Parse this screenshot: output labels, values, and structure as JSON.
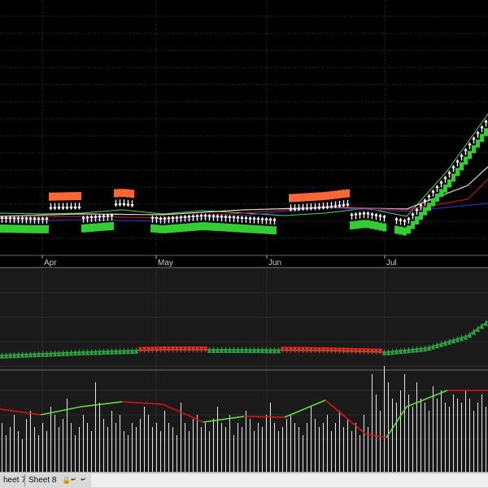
{
  "chart_data": [
    {
      "type": "line",
      "title": "",
      "x_tick_labels": [
        "Apr",
        "May",
        "Jun",
        "Jul"
      ],
      "series": [
        {
          "role": "price",
          "x": [
            0,
            10,
            20,
            30,
            40,
            50,
            60,
            70,
            80,
            90,
            100,
            110,
            120
          ],
          "values": [
            262,
            263,
            262,
            258,
            263,
            259,
            262,
            265,
            262,
            256,
            266,
            210,
            140
          ]
        },
        {
          "role": "sma-short",
          "x": [
            0,
            20,
            40,
            60,
            80,
            100,
            115,
            120
          ],
          "values": [
            266,
            263,
            264,
            258,
            255,
            257,
            228,
            205
          ]
        },
        {
          "role": "sma-mid",
          "x": [
            0,
            20,
            40,
            60,
            80,
            100,
            115,
            120
          ],
          "values": [
            268,
            266,
            268,
            262,
            254,
            258,
            245,
            220
          ]
        },
        {
          "role": "sma-long",
          "x": [
            0,
            20,
            40,
            60,
            80,
            100,
            120
          ],
          "values": [
            272,
            270,
            272,
            265,
            255,
            260,
            250
          ]
        }
      ],
      "signal_up_ranges": [
        [
          0,
          12
        ],
        [
          20,
          28
        ],
        [
          37,
          68
        ],
        [
          86,
          95
        ],
        [
          97,
          120
        ]
      ],
      "signal_down_ranges": [
        [
          12,
          20
        ],
        [
          28,
          33
        ],
        [
          71,
          86
        ],
        [
          88,
          93
        ]
      ],
      "colors": {
        "up": "#33cc33",
        "down": "#ff6633",
        "price": "#ffffff",
        "sma_long": "#3333cc",
        "background": "#000000"
      },
      "grid": true
    },
    {
      "type": "line",
      "title": "",
      "series": [
        {
          "role": "indicator",
          "x": [
            0,
            20,
            40,
            60,
            80,
            95,
            105,
            115,
            120
          ],
          "values": [
            437,
            433,
            430,
            430,
            431,
            433,
            428,
            413,
            395
          ]
        }
      ],
      "up_marker_ranges": [
        [
          0,
          34
        ],
        [
          51,
          69
        ],
        [
          94,
          120
        ]
      ],
      "down_marker_ranges": [
        [
          34,
          51
        ],
        [
          69,
          94
        ]
      ],
      "colors": {
        "up": "#2e9e3e",
        "down": "#ff2222",
        "line": "#2ea44a"
      }
    },
    {
      "type": "bar",
      "title": "",
      "series": [
        {
          "role": "volume-bars",
          "values": [
            60,
            45,
            55,
            70,
            50,
            40,
            65,
            75,
            55,
            45,
            60,
            50,
            80,
            70,
            55,
            65,
            90,
            60,
            45,
            55,
            70,
            60,
            50,
            110,
            85,
            65,
            55,
            75,
            60,
            70,
            50,
            45,
            60,
            55,
            65,
            80,
            70,
            55,
            60,
            50,
            75,
            60,
            55,
            45,
            85,
            60,
            50,
            65,
            70,
            55,
            60,
            50,
            65,
            80,
            60,
            55,
            70,
            45,
            60,
            55,
            75,
            65,
            50,
            60,
            55,
            70,
            85,
            60,
            50,
            55,
            65,
            70,
            60,
            55,
            45,
            60,
            80,
            65,
            55,
            60,
            70,
            50,
            60,
            75,
            55,
            65,
            50,
            60,
            45,
            70,
            55,
            120,
            95,
            75,
            130,
            110,
            90,
            85,
            100,
            120,
            95,
            80,
            110,
            90,
            85,
            75,
            105,
            90,
            100,
            85,
            80,
            95,
            90,
            85,
            100,
            90,
            75,
            85,
            95,
            80
          ]
        },
        {
          "role": "oscillator-line",
          "x": [
            0,
            10,
            20,
            30,
            40,
            50,
            60,
            70,
            80,
            90,
            95,
            100,
            110,
            120
          ],
          "values": [
            503,
            510,
            500,
            494,
            497,
            519,
            512,
            513,
            492,
            534,
            538,
            500,
            480,
            480
          ]
        }
      ],
      "colors": {
        "bars": "#e6e6e6",
        "line_up": "#66dd44",
        "line_down": "#dd1111",
        "line_flat": "#ffff66"
      }
    }
  ],
  "tabs": {
    "items": [
      "heet 7",
      "Sheet 8"
    ]
  }
}
